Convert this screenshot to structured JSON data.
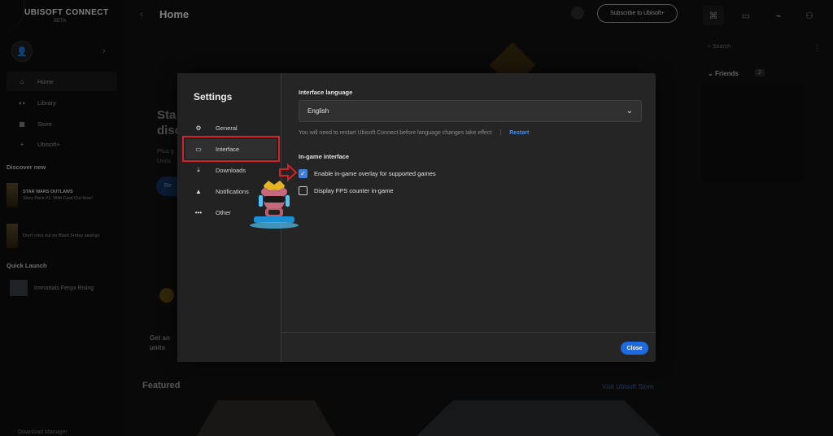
{
  "brand": {
    "name": "UBISOFT CONNECT",
    "sub": "BETA"
  },
  "sidebar": {
    "nav": [
      {
        "label": "Home",
        "icon": "home-icon"
      },
      {
        "label": "Library",
        "icon": "controller-icon"
      },
      {
        "label": "Store",
        "icon": "store-icon"
      },
      {
        "label": "Ubisoft+",
        "icon": "plus-icon"
      }
    ],
    "discover_title": "Discover new",
    "promos": [
      {
        "title": "STAR WARS OUTLAWS",
        "text": "Story Pack #1: Wild Card Out Now!"
      },
      {
        "title": "",
        "text": "Don't miss out on Black Friday savings"
      }
    ],
    "quick_launch_title": "Quick Launch",
    "quick_launch_item": "Immortals Fenyx Rising",
    "download_manager": "Download Manager"
  },
  "header": {
    "title": "Home",
    "subscribe": "Subscribe to Ubisoft+"
  },
  "right_panel": {
    "search_placeholder": "Search",
    "friends_label": "Friends",
    "friends_count": "2"
  },
  "background": {
    "hero_line1": "Sta",
    "hero_line2": "disc",
    "hero_sub1": "Plus g",
    "hero_sub2": "Units",
    "hero_btn": "Re",
    "get_line1": "Get an",
    "get_line2": "units",
    "featured": "Featured",
    "visit": "Visit Ubisoft Store"
  },
  "settings": {
    "title": "Settings",
    "menu": [
      {
        "label": "General",
        "icon": "gear-icon"
      },
      {
        "label": "Interface",
        "icon": "monitor-icon"
      },
      {
        "label": "Downloads",
        "icon": "download-icon"
      },
      {
        "label": "Notifications",
        "icon": "bell-icon"
      },
      {
        "label": "Other",
        "icon": "more-icon"
      }
    ],
    "interface_language_label": "Interface language",
    "language_value": "English",
    "restart_note": "You will need to restart Ubisoft Connect before language changes take effect",
    "restart_link": "Restart",
    "ingame_label": "In-game interface",
    "options": [
      {
        "label": "Enable in-game overlay for supported games",
        "checked": true
      },
      {
        "label": "Display FPS counter in-game",
        "checked": false
      }
    ],
    "close": "Close"
  },
  "colors": {
    "accent": "#1e6be0",
    "highlight": "#d42127",
    "checkbox_on": "#3f7fe0"
  }
}
